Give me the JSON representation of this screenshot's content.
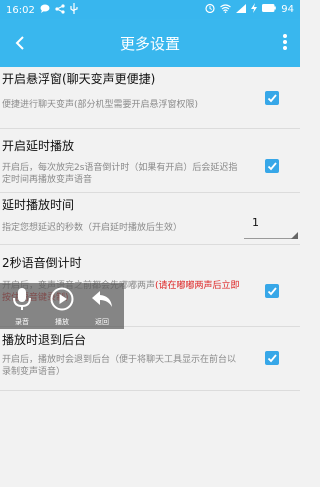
{
  "status": {
    "time": "16:02",
    "battery": "94"
  },
  "appbar": {
    "title": "更多设置"
  },
  "settings": [
    {
      "title": "开启悬浮窗(聊天变声更便捷)",
      "desc": "便捷进行聊天变声(部分机型需要开启悬浮窗权限)",
      "checked": true
    },
    {
      "title": "开启延时播放",
      "desc": "开启后，每次放完2s语音倒计时（如果有开启）后会延迟指定时间再播放变声语音",
      "checked": true
    },
    {
      "title": "延时播放时间",
      "desc": "指定您想延迟的秒数（开启延时播放后生效）",
      "value": "1"
    },
    {
      "title": "2秒语音倒计时",
      "desc": "开启后，变声语音之前都会先嘟嘟两声",
      "desc_warning": "(请在嘟嘟两声后立即按住语音键录制)",
      "checked": true
    },
    {
      "title": "播放时退到后台",
      "desc": "开启后，播放时会退到后台（便于将聊天工具显示在前台以录制变声语音）",
      "checked": true
    }
  ],
  "floating": {
    "record_label": "录音",
    "play_label": "播放",
    "back_label": "返回"
  },
  "colors": {
    "accent": "#39b7ee",
    "checkbox": "#37a7e8",
    "warning": "#dd2222"
  }
}
